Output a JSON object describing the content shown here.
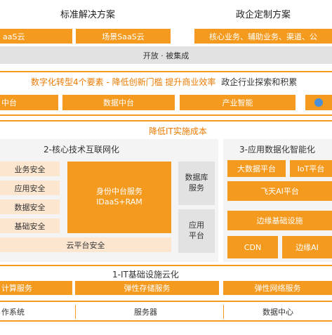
{
  "top": {
    "left_title": "标准解决方案",
    "right_title": "政企定制方案",
    "left_items": [
      "aaS云",
      "场景SaaS云"
    ],
    "right_items": [
      "核心业务、辅助业务、渠道、公"
    ],
    "integration": "开放 · 被集成"
  },
  "middle": {
    "title": "数字化转型4个要素 - 降低创新门槛  提升商业效率",
    "title_tail": "政企行业探索和积累",
    "items": [
      "中台",
      "数据中台",
      "产业智能"
    ]
  },
  "lower": {
    "title": "降低IT实施成本",
    "core_title": "2-核心技术互联网化",
    "security_items": [
      "业务安全",
      "应用安全",
      "数据安全",
      "基础安全"
    ],
    "cloud_security": "云平台安全",
    "identity_service": "身份中台服务\nIDaaS+RAM",
    "database_service": "数据库\n服务",
    "app_platform": "应用\n平台",
    "app_title": "3-应用数据化智能化",
    "bigdata": "大数据平台",
    "iot": "IoT平台",
    "feitian_ai": "飞天AI平台",
    "edge_infra": "边缘基础设施",
    "cdn": "CDN",
    "edge_ai": "边缘AI"
  },
  "infra": {
    "title": "1-IT基础设施云化",
    "services": [
      "计算服务",
      "弹性存储服务",
      "弹性网络服务"
    ],
    "bottom": [
      "作系统",
      "服务器",
      "数据中心"
    ]
  },
  "colors": {
    "accent": "#f39a1f",
    "light": "#fde6cf",
    "gray": "#e2e2e2",
    "title_orange": "#ea7a00"
  }
}
